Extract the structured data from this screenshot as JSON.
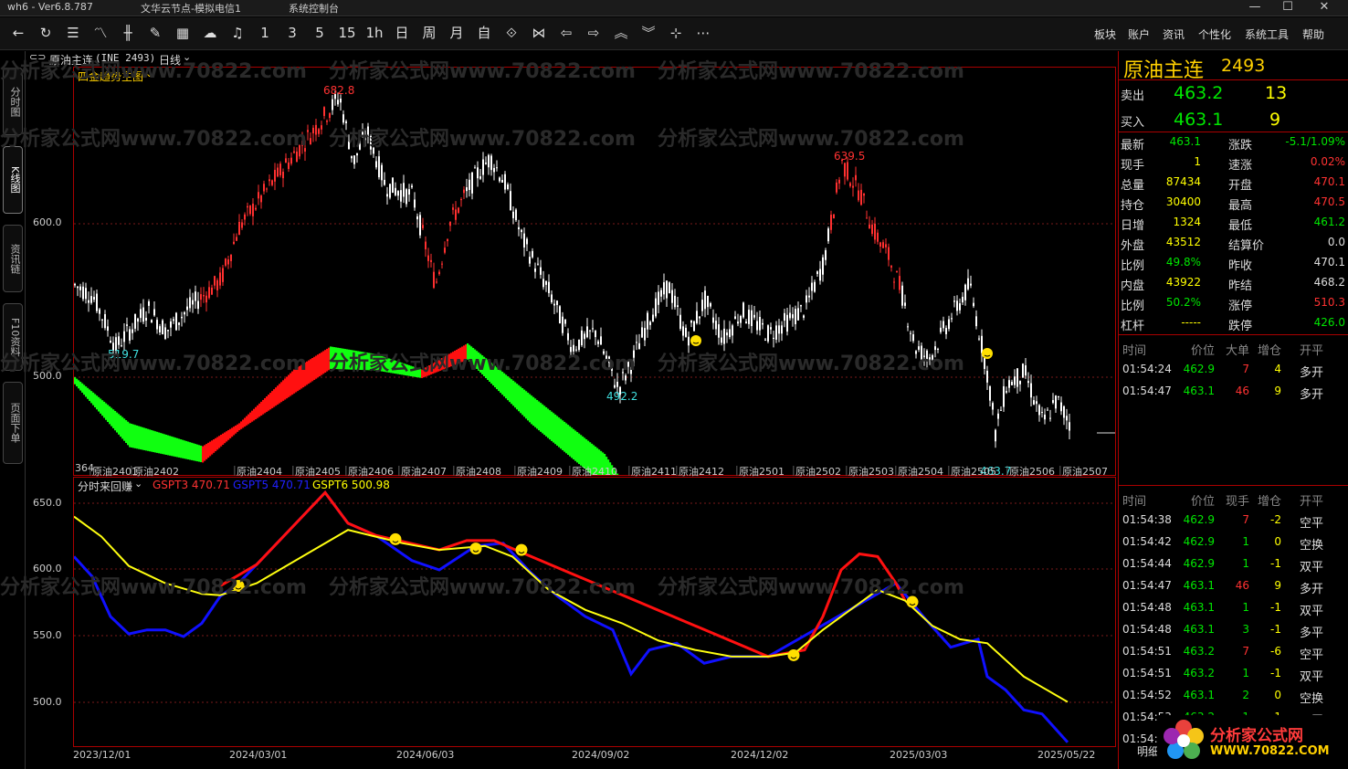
{
  "title_bar": {
    "app": "wh6 - Ver6.8.787",
    "node": "文华云节点-模拟电信1",
    "console": "系统控制台"
  },
  "toolbar": {
    "periods": [
      "1",
      "3",
      "5",
      "15",
      "1h",
      "日",
      "周",
      "月",
      "自"
    ],
    "menus": [
      "板块",
      "账户",
      "资讯",
      "个性化",
      "系统工具",
      "帮助"
    ]
  },
  "left_tabs": [
    "分时图",
    "K线图",
    "资讯链",
    "F10资料",
    "页面下单"
  ],
  "instrument": {
    "name": "原油主连",
    "code": "(INE 2493)",
    "period": "日线",
    "panel_name": "原油主连",
    "panel_code": "2493"
  },
  "main": {
    "indicator": "四金趋势主图",
    "price_labels": [
      "600.0",
      "500.0"
    ],
    "annotations": [
      "682.8",
      "639.5",
      "519.7",
      "492.2",
      "463.7",
      "364"
    ],
    "contracts": [
      "原油2401",
      "原油2402",
      "原油2404",
      "原油2405",
      "原油2406",
      "原油2407",
      "原油2408",
      "原油2409",
      "原油2410",
      "原油2411",
      "原油2412",
      "原油2501",
      "原油2502",
      "原油2503",
      "原油2504",
      "原油2505",
      "原油2506",
      "原油2507"
    ]
  },
  "sub": {
    "indicator": "分时来回赚",
    "gspt3": "GSPT3 470.71",
    "gspt5": "GSPT5 470.71",
    "gspt6": "GSPT6 500.98",
    "price_labels": [
      "650.0",
      "600.0",
      "550.0",
      "500.0"
    ]
  },
  "dates": [
    "2023/12/01",
    "2024/03/01",
    "2024/06/03",
    "2024/09/02",
    "2024/12/02",
    "2025/03/03",
    "2025/05/22"
  ],
  "quote": {
    "sell_label": "卖出",
    "sell_price": "463.2",
    "sell_vol": "13",
    "buy_label": "买入",
    "buy_price": "463.1",
    "buy_vol": "9",
    "stats": [
      [
        "最新",
        "463.1",
        "涨跌",
        "-5.1/1.09%"
      ],
      [
        "现手",
        "1",
        "速涨",
        "0.02%"
      ],
      [
        "总量",
        "87434",
        "开盘",
        "470.1"
      ],
      [
        "持仓",
        "30400",
        "最高",
        "470.5"
      ],
      [
        "日增",
        "1324",
        "最低",
        "461.2"
      ],
      [
        "外盘",
        "43512",
        "结算价",
        "0.0"
      ],
      [
        "比例",
        "49.8%",
        "昨收",
        "470.1"
      ],
      [
        "内盘",
        "43922",
        "昨结",
        "468.2"
      ],
      [
        "比例",
        "50.2%",
        "涨停",
        "510.3"
      ],
      [
        "杠杆",
        "-----",
        "跌停",
        "426.0"
      ]
    ]
  },
  "big_orders": {
    "headers": [
      "时间",
      "价位",
      "大单",
      "增仓",
      "开平"
    ],
    "rows": [
      [
        "01:54:24",
        "462.9",
        "7",
        "4",
        "多开"
      ],
      [
        "01:54:47",
        "463.1",
        "46",
        "9",
        "多开"
      ]
    ]
  },
  "ticks": {
    "headers": [
      "时间",
      "价位",
      "现手",
      "增仓",
      "开平"
    ],
    "rows": [
      [
        "01:54:38",
        "462.9",
        "7",
        "-2",
        "空平"
      ],
      [
        "01:54:42",
        "462.9",
        "1",
        "0",
        "空换"
      ],
      [
        "01:54:44",
        "462.9",
        "1",
        "-1",
        "双平"
      ],
      [
        "01:54:47",
        "463.1",
        "46",
        "9",
        "多开"
      ],
      [
        "01:54:48",
        "463.1",
        "1",
        "-1",
        "双平"
      ],
      [
        "01:54:48",
        "463.1",
        "3",
        "-1",
        "多平"
      ],
      [
        "01:54:51",
        "463.2",
        "7",
        "-6",
        "空平"
      ],
      [
        "01:54:51",
        "463.2",
        "1",
        "-1",
        "双平"
      ],
      [
        "01:54:52",
        "463.1",
        "2",
        "0",
        "空换"
      ],
      [
        "01:54:53",
        "463.2",
        "1",
        "-1",
        "双平"
      ],
      [
        "01:54:",
        "",
        "",
        "",
        ""
      ]
    ]
  },
  "bottom_tab": "明细",
  "watermark": "分析家公式网www.70822.com",
  "logo": {
    "text": "分析家公式网",
    "url": "WWW.70822.COM"
  },
  "colors": {
    "up": "#ff3232",
    "down": "#00e600",
    "accent": "#a00000"
  }
}
